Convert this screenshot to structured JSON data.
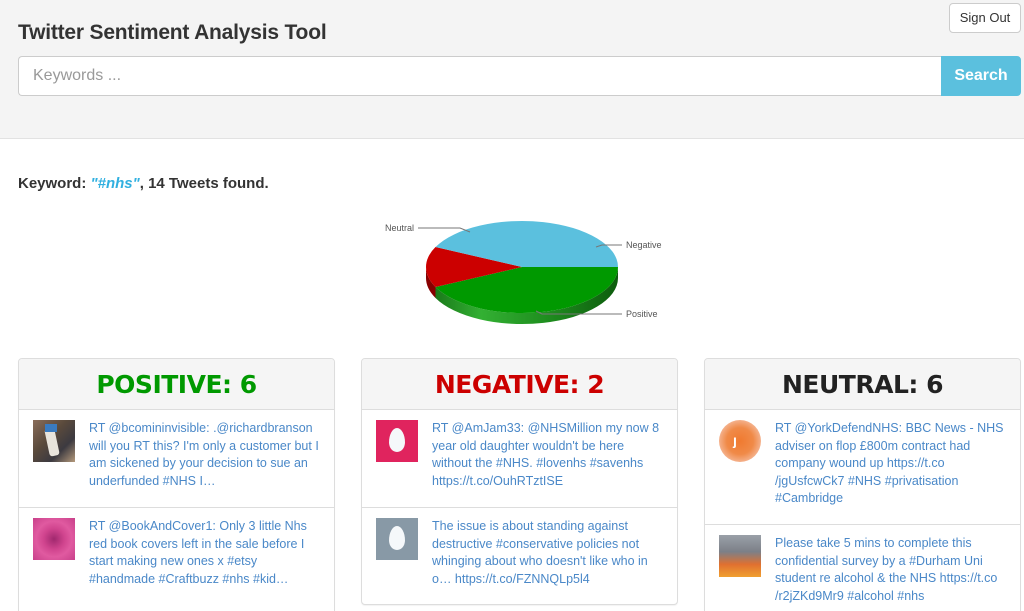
{
  "header": {
    "title": "Twitter Sentiment Analysis Tool",
    "sign_out_label": "Sign Out",
    "search": {
      "placeholder": "Keywords ...",
      "value": "",
      "button_label": "Search"
    }
  },
  "result": {
    "prefix": "Keyword: ",
    "keyword": "\"#nhs\"",
    "suffix": ", 14 Tweets found."
  },
  "colors": {
    "positive": "#009900",
    "negative": "#cc0000",
    "neutral": "#5bc0de",
    "accent": "#5bc0de",
    "link": "#4a88c8"
  },
  "chart_data": {
    "type": "pie",
    "style": "3d",
    "title": "",
    "categories": [
      "Positive",
      "Negative",
      "Neutral"
    ],
    "values": [
      6,
      2,
      6
    ],
    "total": 14,
    "legend": "labels-with-leader-lines"
  },
  "panels": [
    {
      "title": "POSITIVE: 6",
      "sentiment": "positive",
      "tweets": [
        {
          "avatar": "guitar-photo",
          "text": "RT @bcomininvisible: .@richardbranson will you RT this? I'm only a customer but I am sickened by your decision to sue an underfunded #NHS I…"
        },
        {
          "avatar": "rose-photo",
          "text": "RT @BookAndCover1: Only 3 little Nhs red book covers left in the sale before I start making new ones x #etsy #handmade #Craftbuzz #nhs #kid…"
        }
      ]
    },
    {
      "title": "NEGATIVE: 2",
      "sentiment": "negative",
      "tweets": [
        {
          "avatar": "default-egg-pink",
          "text": "RT @AmJam33: @NHSMillion my now 8 year old daughter wouldn't be here without the #NHS. #lovenhs #savenhs https://t.co/OuhRTztISE"
        },
        {
          "avatar": "default-egg-grey",
          "text": "The issue is about standing against destructive #conservative policies not whinging about who doesn't like who in o… https://t.co/FZNNQLp5l4"
        }
      ]
    },
    {
      "title": "NEUTRAL: 6",
      "sentiment": "neutral",
      "tweets": [
        {
          "avatar": "orange-logo",
          "text": "RT @YorkDefendNHS: BBC News - NHS adviser on flop £800m contract had company wound up https://t.co /jgUsfcwCk7 #NHS #privatisation #Cambridge"
        },
        {
          "avatar": "fire-photo",
          "text": "Please take 5 mins to complete this confidential survey by a #Durham Uni student re alcohol & the NHS https://t.co /r2jZKd9Mr9 #alcohol #nhs"
        }
      ]
    }
  ]
}
